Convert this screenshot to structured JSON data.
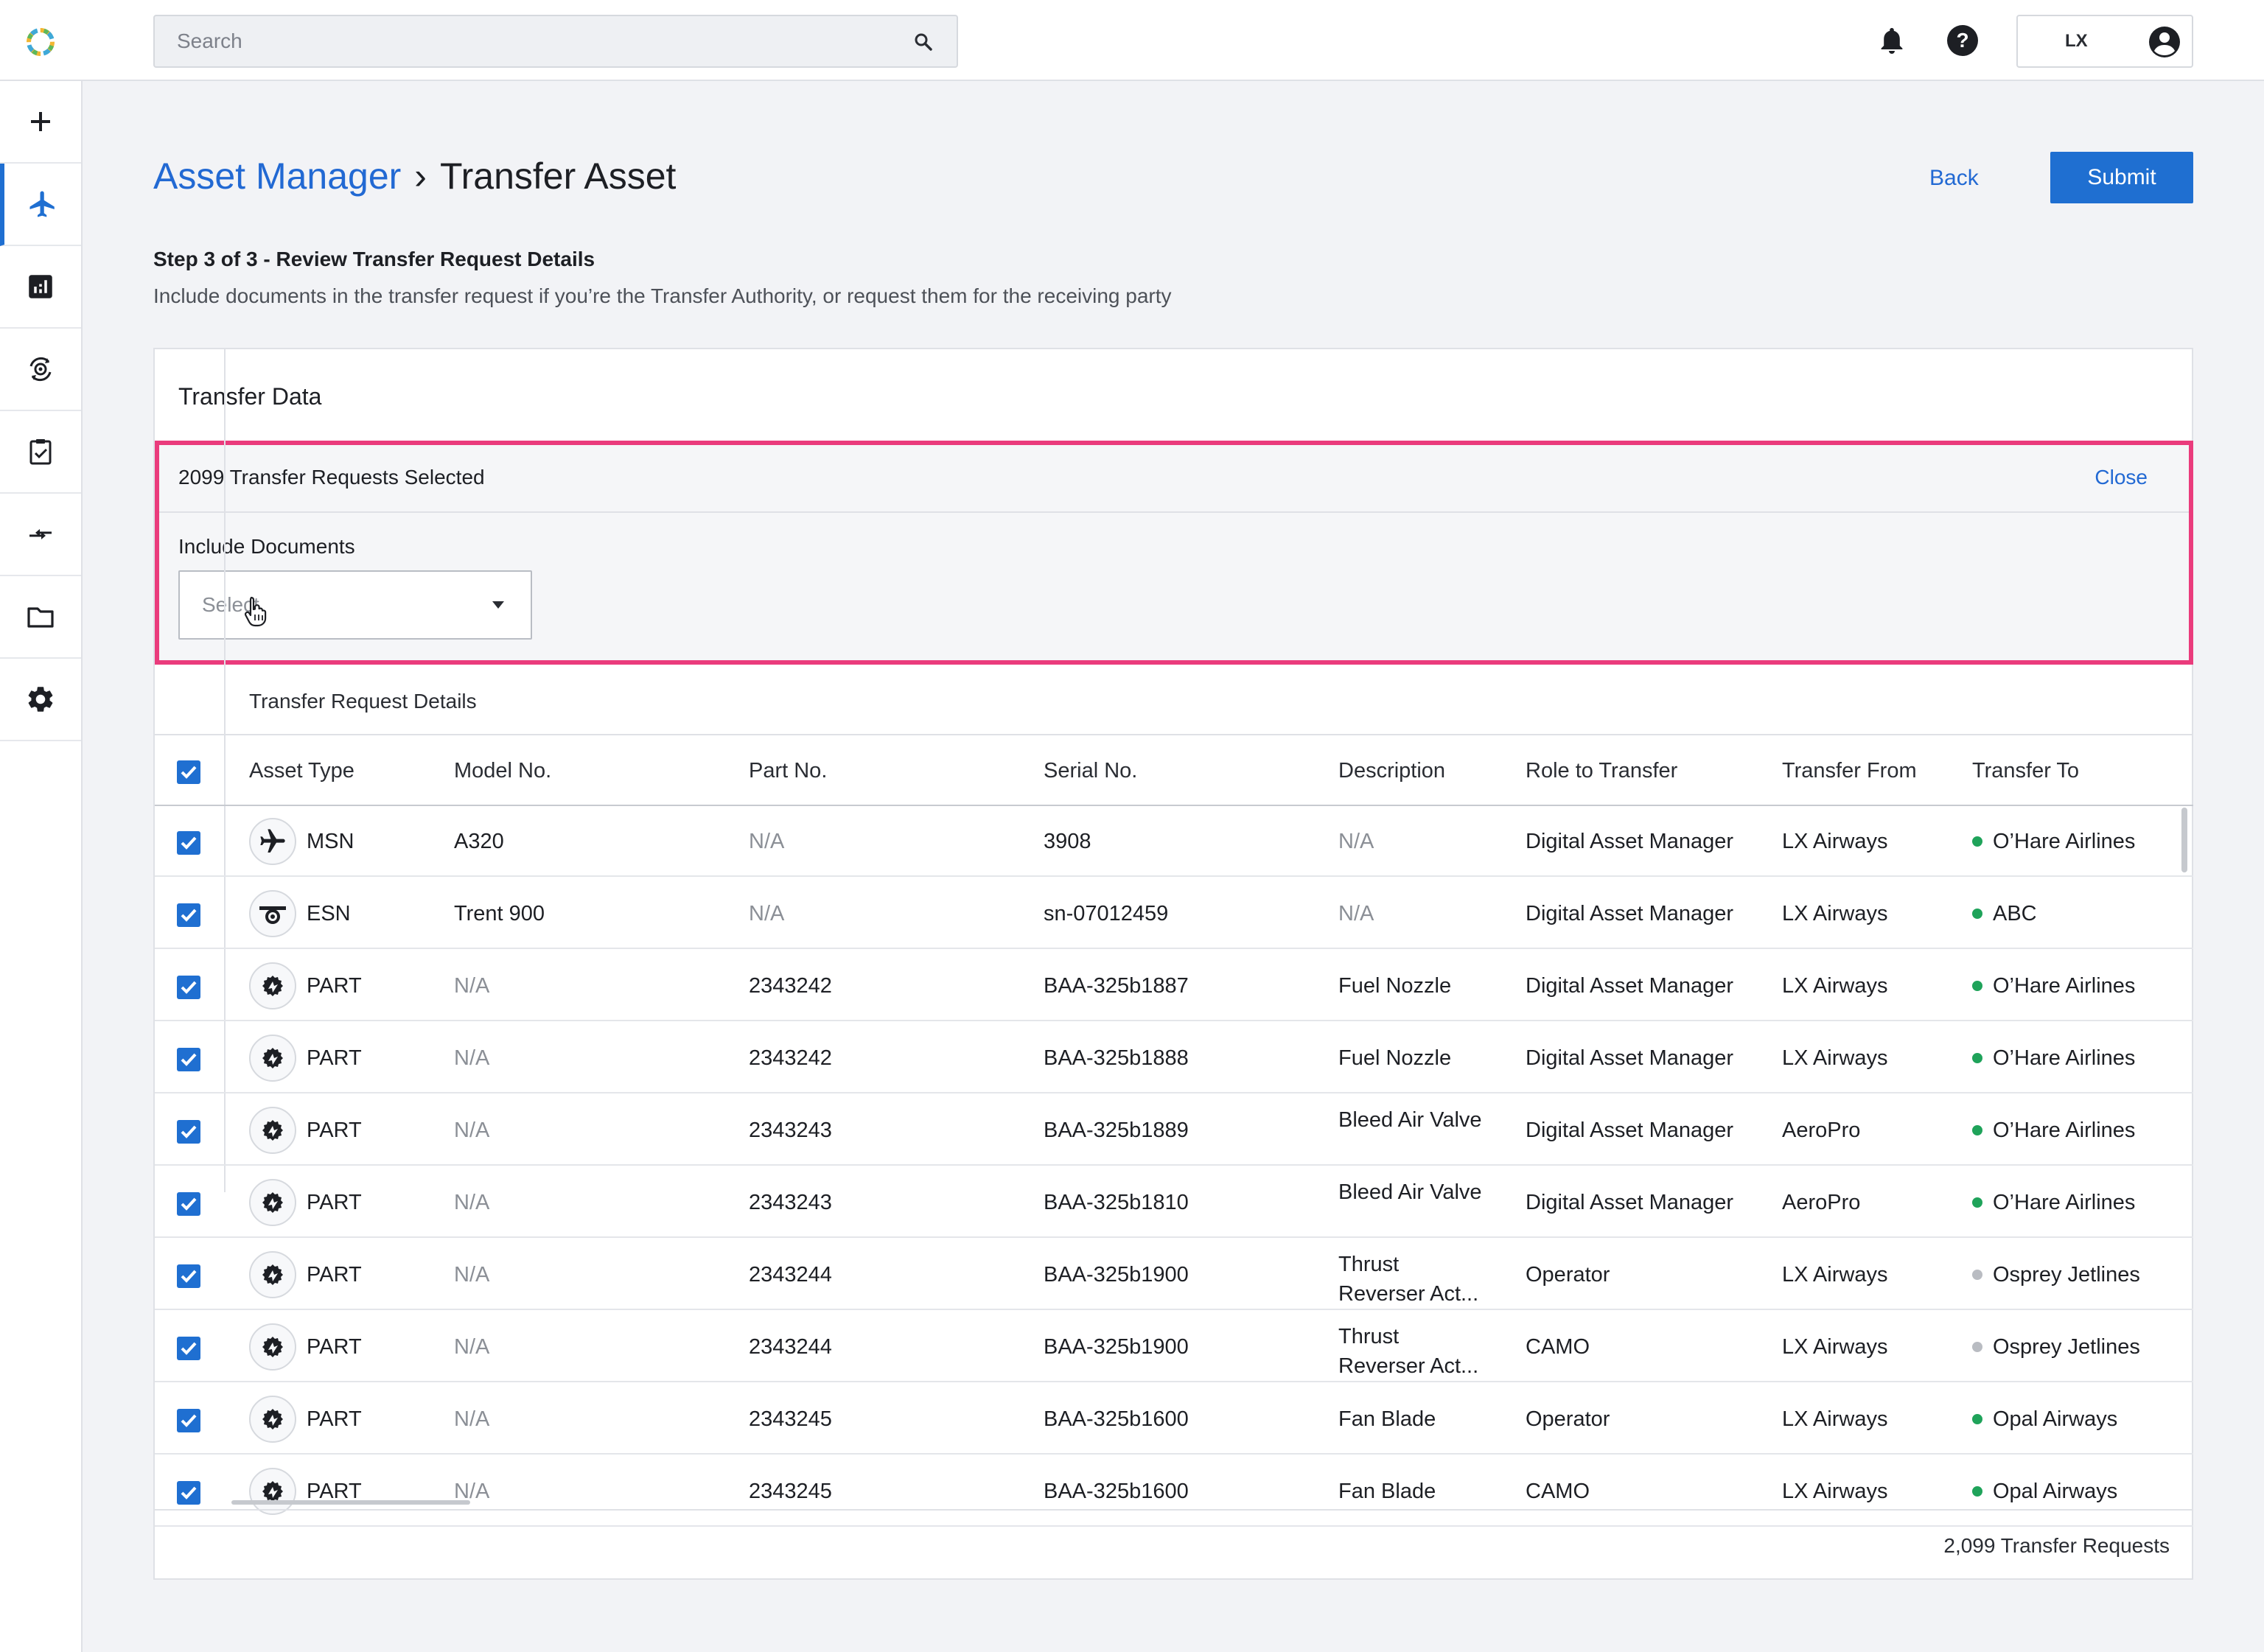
{
  "header": {
    "search_placeholder": "Search",
    "user_initials": "LX"
  },
  "nav": {
    "items": [
      {
        "icon": "plus-icon"
      },
      {
        "icon": "airplane-icon",
        "active": true
      },
      {
        "icon": "analytics-icon"
      },
      {
        "icon": "engine-sync-icon"
      },
      {
        "icon": "clipboard-check-icon"
      },
      {
        "icon": "transfer-arrows-icon"
      },
      {
        "icon": "folder-icon"
      },
      {
        "icon": "settings-gear-icon"
      }
    ]
  },
  "page": {
    "breadcrumb_parent": "Asset Manager",
    "breadcrumb_separator": "›",
    "breadcrumb_current": "Transfer Asset",
    "back_label": "Back",
    "submit_label": "Submit",
    "step_title": "Step 3 of 3 - Review Transfer Request Details",
    "step_description": "Include documents in the transfer request if you’re the Transfer Authority, or request them for the receiving party"
  },
  "card": {
    "title": "Transfer Data",
    "selection": {
      "count_text": "2099 Transfer Requests Selected",
      "close_label": "Close",
      "include_label": "Include Documents",
      "select_placeholder": "Select"
    },
    "table": {
      "group_title": "Transfer Request Details",
      "columns": [
        "Asset Type",
        "Model No.",
        "Part No.",
        "Serial No.",
        "Description",
        "Role to Transfer",
        "Transfer From",
        "Transfer To"
      ],
      "rows": [
        {
          "asset_type": "MSN",
          "icon": "airplane-icon",
          "model_no": "A320",
          "part_no": "N/A",
          "serial_no": "3908",
          "description": "N/A",
          "role": "Digital Asset Manager",
          "from": "LX Airways",
          "to": "O’Hare Airlines",
          "status": "active"
        },
        {
          "asset_type": "ESN",
          "icon": "engine-icon",
          "model_no": "Trent 900",
          "part_no": "N/A",
          "serial_no": "sn-07012459",
          "description": "N/A",
          "role": "Digital Asset Manager",
          "from": "LX Airways",
          "to": "ABC",
          "status": "active"
        },
        {
          "asset_type": "PART",
          "icon": "part-gear-icon",
          "model_no": "N/A",
          "part_no": "2343242",
          "serial_no": "BAA-325b1887",
          "description": "Fuel Nozzle",
          "role": "Digital Asset Manager",
          "from": "LX Airways",
          "to": "O’Hare Airlines",
          "status": "active"
        },
        {
          "asset_type": "PART",
          "icon": "part-gear-icon",
          "model_no": "N/A",
          "part_no": "2343242",
          "serial_no": "BAA-325b1888",
          "description": "Fuel Nozzle",
          "role": "Digital Asset Manager",
          "from": "LX Airways",
          "to": "O’Hare Airlines",
          "status": "active"
        },
        {
          "asset_type": "PART",
          "icon": "part-gear-icon",
          "model_no": "N/A",
          "part_no": "2343243",
          "serial_no": "BAA-325b1889",
          "description": "Bleed Air Valve",
          "role": "Digital Asset Manager",
          "from": "AeroPro",
          "to": "O’Hare Airlines",
          "status": "active"
        },
        {
          "asset_type": "PART",
          "icon": "part-gear-icon",
          "model_no": "N/A",
          "part_no": "2343243",
          "serial_no": "BAA-325b1810",
          "description": "Bleed Air Valve",
          "role": "Digital Asset Manager",
          "from": "AeroPro",
          "to": "O’Hare Airlines",
          "status": "active"
        },
        {
          "asset_type": "PART",
          "icon": "part-gear-icon",
          "model_no": "N/A",
          "part_no": "2343244",
          "serial_no": "BAA-325b1900",
          "description": "Thrust Reverser Act...",
          "role": "Operator",
          "from": "LX Airways",
          "to": "Osprey Jetlines",
          "status": "inactive"
        },
        {
          "asset_type": "PART",
          "icon": "part-gear-icon",
          "model_no": "N/A",
          "part_no": "2343244",
          "serial_no": "BAA-325b1900",
          "description": "Thrust Reverser Act...",
          "role": "CAMO",
          "from": "LX Airways",
          "to": "Osprey Jetlines",
          "status": "inactive"
        },
        {
          "asset_type": "PART",
          "icon": "part-gear-icon",
          "model_no": "N/A",
          "part_no": "2343245",
          "serial_no": "BAA-325b1600",
          "description": "Fan Blade",
          "role": "Operator",
          "from": "LX Airways",
          "to": "Opal Airways",
          "status": "active"
        },
        {
          "asset_type": "PART",
          "icon": "part-gear-icon",
          "model_no": "N/A",
          "part_no": "2343245",
          "serial_no": "BAA-325b1600",
          "description": "Fan Blade",
          "role": "CAMO",
          "from": "LX Airways",
          "to": "Opal Airways",
          "status": "active"
        }
      ],
      "footer_count": "2,099 Transfer Requests"
    }
  },
  "colors": {
    "accent": "#1f6fd1",
    "link": "#2269d3",
    "highlight_border": "#ea3b7c",
    "status_active": "#1fa35a",
    "status_inactive": "#b9bcc2"
  }
}
